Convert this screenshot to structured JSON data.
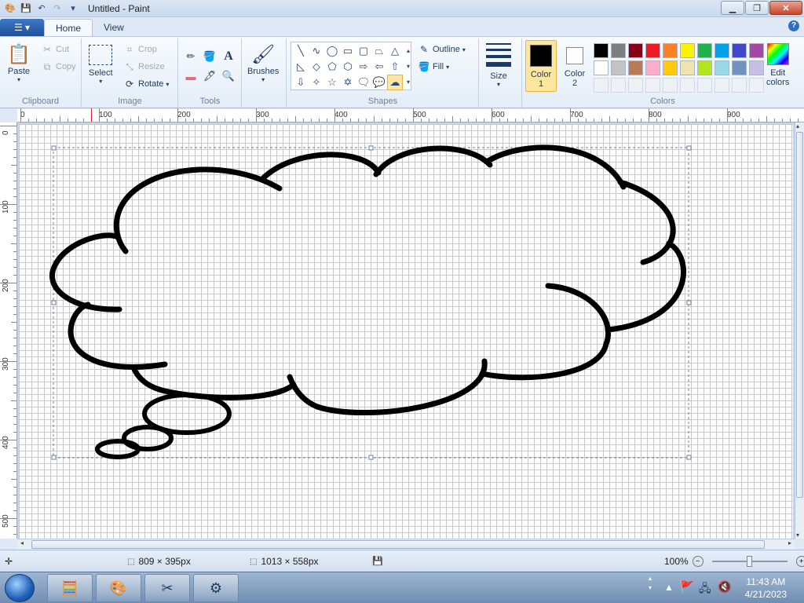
{
  "window": {
    "title": "Untitled - Paint"
  },
  "tabs": [
    {
      "label": "Home"
    },
    {
      "label": "View"
    }
  ],
  "ribbon": {
    "clipboard": {
      "paste": "Paste",
      "cut": "Cut",
      "copy": "Copy",
      "label": "Clipboard"
    },
    "image": {
      "select": "Select",
      "crop": "Crop",
      "resize": "Resize",
      "rotate": "Rotate",
      "label": "Image"
    },
    "tools": {
      "label": "Tools"
    },
    "brushes": {
      "label": "Brushes"
    },
    "shapes": {
      "outline": "Outline",
      "fill": "Fill",
      "label": "Shapes"
    },
    "size": {
      "label": "Size"
    },
    "colors": {
      "color1_label": "Color\n1",
      "color1_line1": "Color",
      "color1_line2": "1",
      "color2_line1": "Color",
      "color2_line2": "2",
      "edit_line1": "Edit",
      "edit_line2": "colors",
      "label": "Colors",
      "color1_value": "#000000",
      "color2_value": "#ffffff",
      "palette_row1": [
        "#000000",
        "#7f7f7f",
        "#880015",
        "#ed1c24",
        "#ff7f27",
        "#fff200",
        "#22b14c",
        "#00a2e8",
        "#3f48cc",
        "#a349a4"
      ],
      "palette_row2": [
        "#ffffff",
        "#c3c3c3",
        "#b97a57",
        "#ffaec9",
        "#ffc90e",
        "#efe4b0",
        "#b5e61d",
        "#99d9ea",
        "#7092be",
        "#c8bfe7"
      ]
    }
  },
  "ruler": {
    "h_labels": [
      "0",
      "100",
      "200",
      "300",
      "400",
      "500",
      "600",
      "700",
      "800",
      "900"
    ],
    "v_labels": [
      "0",
      "100",
      "200",
      "300",
      "400",
      "500"
    ]
  },
  "status": {
    "selection_size": "809 × 395px",
    "canvas_size": "1013 × 558px",
    "zoom": "100%"
  },
  "taskbar": {
    "time": "11:43 AM",
    "date": "4/21/2023"
  }
}
